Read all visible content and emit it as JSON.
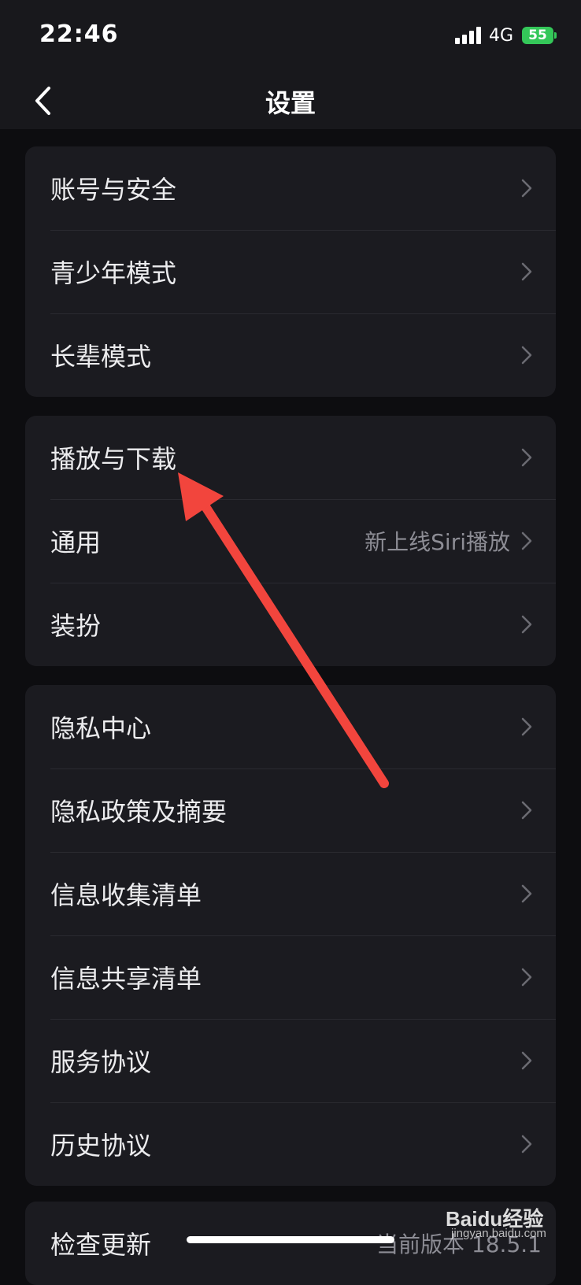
{
  "status": {
    "time": "22:46",
    "network": "4G",
    "battery": "55"
  },
  "nav": {
    "title": "设置",
    "back_icon": "chevron-left-icon"
  },
  "groups": [
    {
      "rows": [
        {
          "label": "账号与安全"
        },
        {
          "label": "青少年模式"
        },
        {
          "label": "长辈模式"
        }
      ]
    },
    {
      "rows": [
        {
          "label": "播放与下载"
        },
        {
          "label": "通用",
          "value": "新上线Siri播放"
        },
        {
          "label": "装扮"
        }
      ]
    },
    {
      "rows": [
        {
          "label": "隐私中心"
        },
        {
          "label": "隐私政策及摘要"
        },
        {
          "label": "信息收集清单"
        },
        {
          "label": "信息共享清单"
        },
        {
          "label": "服务协议"
        },
        {
          "label": "历史协议"
        }
      ]
    },
    {
      "rows": [
        {
          "label": "检查更新",
          "value": "当前版本 18.5.1"
        }
      ]
    }
  ],
  "watermark": {
    "brand": "Baidu经验",
    "url": "jingyan.baidu.com"
  },
  "annotation": {
    "arrow_color": "#f2453d"
  },
  "colors": {
    "battery": "#34c759",
    "background": "#0d0d10",
    "card": "#1b1b20"
  }
}
